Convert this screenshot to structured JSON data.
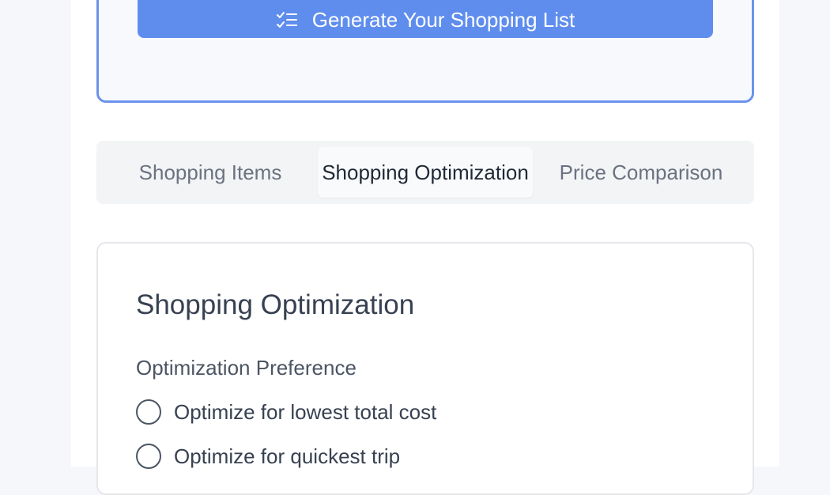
{
  "generate": {
    "button_label": "Generate Your Shopping List",
    "icon": "checklist-icon"
  },
  "tabs": [
    {
      "label": "Shopping Items",
      "active": false
    },
    {
      "label": "Shopping Optimization",
      "active": true
    },
    {
      "label": "Price Comparison",
      "active": false
    }
  ],
  "optimization": {
    "title": "Shopping Optimization",
    "preference_label": "Optimization Preference",
    "options": [
      {
        "label": "Optimize for lowest total cost",
        "selected": false
      },
      {
        "label": "Optimize for quickest trip",
        "selected": false
      }
    ]
  },
  "colors": {
    "accent": "#5f8dee",
    "panel_border": "#6b93ec"
  }
}
